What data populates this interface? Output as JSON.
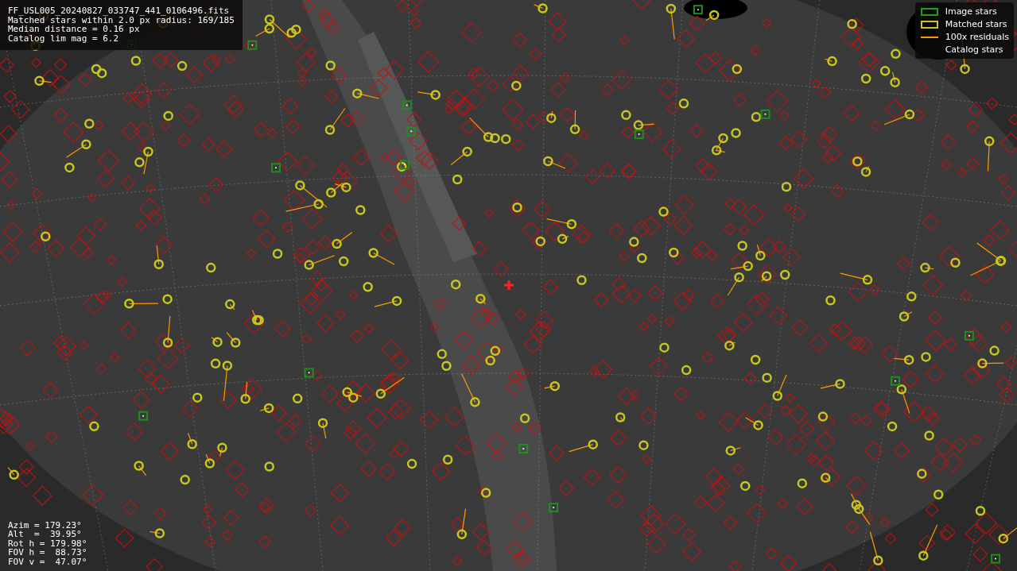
{
  "info_box": {
    "lines": [
      "FF_USL005_20240827_033747_441_0106496.fits",
      "Matched stars within 2.0 px radius: 169/185",
      "Median distance = 0.16 px",
      "Catalog lim mag = 6.2"
    ]
  },
  "legend": [
    {
      "label": "Image stars"
    },
    {
      "kind": "matched",
      "label": "Matched stars"
    },
    {
      "kind": "residual",
      "label": "100x residuals"
    },
    {
      "kind": "catalog",
      "label": "Catalog stars"
    }
  ],
  "pointing": {
    "lines": [
      "Azim = 179.23°",
      "Alt  =  39.95°",
      "Rot h = 179.98°",
      "FOV h =  88.73°",
      "FOV v =  47.07°"
    ]
  }
}
